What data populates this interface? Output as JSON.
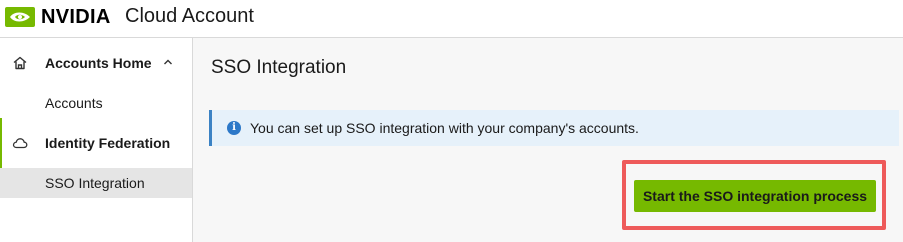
{
  "header": {
    "brand_word": "NVIDIA",
    "brand_icon": "nvidia-logo-icon",
    "app_title": "Cloud Account",
    "brand_color": "#76b900"
  },
  "sidebar": {
    "items": [
      {
        "label": "Accounts Home",
        "icon": "home-icon",
        "expanded_icon": "chevron-up-icon"
      },
      {
        "label": "Accounts"
      },
      {
        "label": "Identity Federation",
        "icon": "cloud-icon"
      },
      {
        "label": "SSO Integration",
        "selected": true
      }
    ]
  },
  "main": {
    "title": "SSO Integration",
    "info_icon": "info-icon",
    "info_text": "You can set up SSO integration with your company's accounts.",
    "primary_button_label": "Start the SSO integration process",
    "highlight_color": "#ee5a5a"
  }
}
